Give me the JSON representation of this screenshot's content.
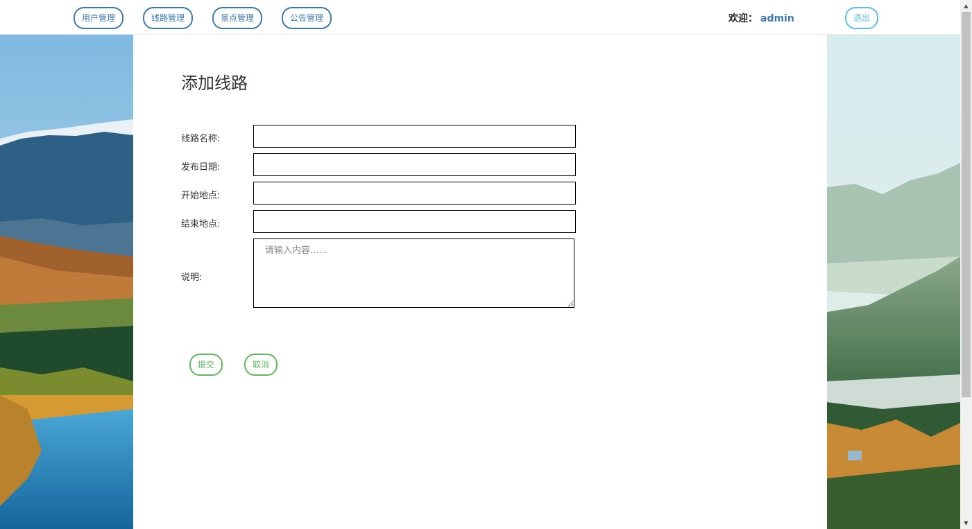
{
  "nav": {
    "items": [
      {
        "label": "用户管理"
      },
      {
        "label": "线路管理"
      },
      {
        "label": "景点管理"
      },
      {
        "label": "公告管理"
      }
    ],
    "welcome_label": "欢迎：",
    "username": "admin",
    "logout_label": "退出"
  },
  "form": {
    "title": "添加线路",
    "fields": [
      {
        "label": "线路名称:",
        "value": ""
      },
      {
        "label": "发布日期:",
        "value": ""
      },
      {
        "label": "开始地点:",
        "value": ""
      },
      {
        "label": "结束地点:",
        "value": ""
      }
    ],
    "description": {
      "label": "说明:",
      "placeholder": "请输入内容......",
      "value": ""
    },
    "submit_label": "提交",
    "cancel_label": "取消"
  },
  "colors": {
    "nav_accent": "#3a78ad",
    "logout_accent": "#5bc0de",
    "action_accent": "#5cb85c"
  },
  "icons": {
    "scroll_up": "triangle-up-icon",
    "scroll_down": "triangle-down-icon"
  }
}
